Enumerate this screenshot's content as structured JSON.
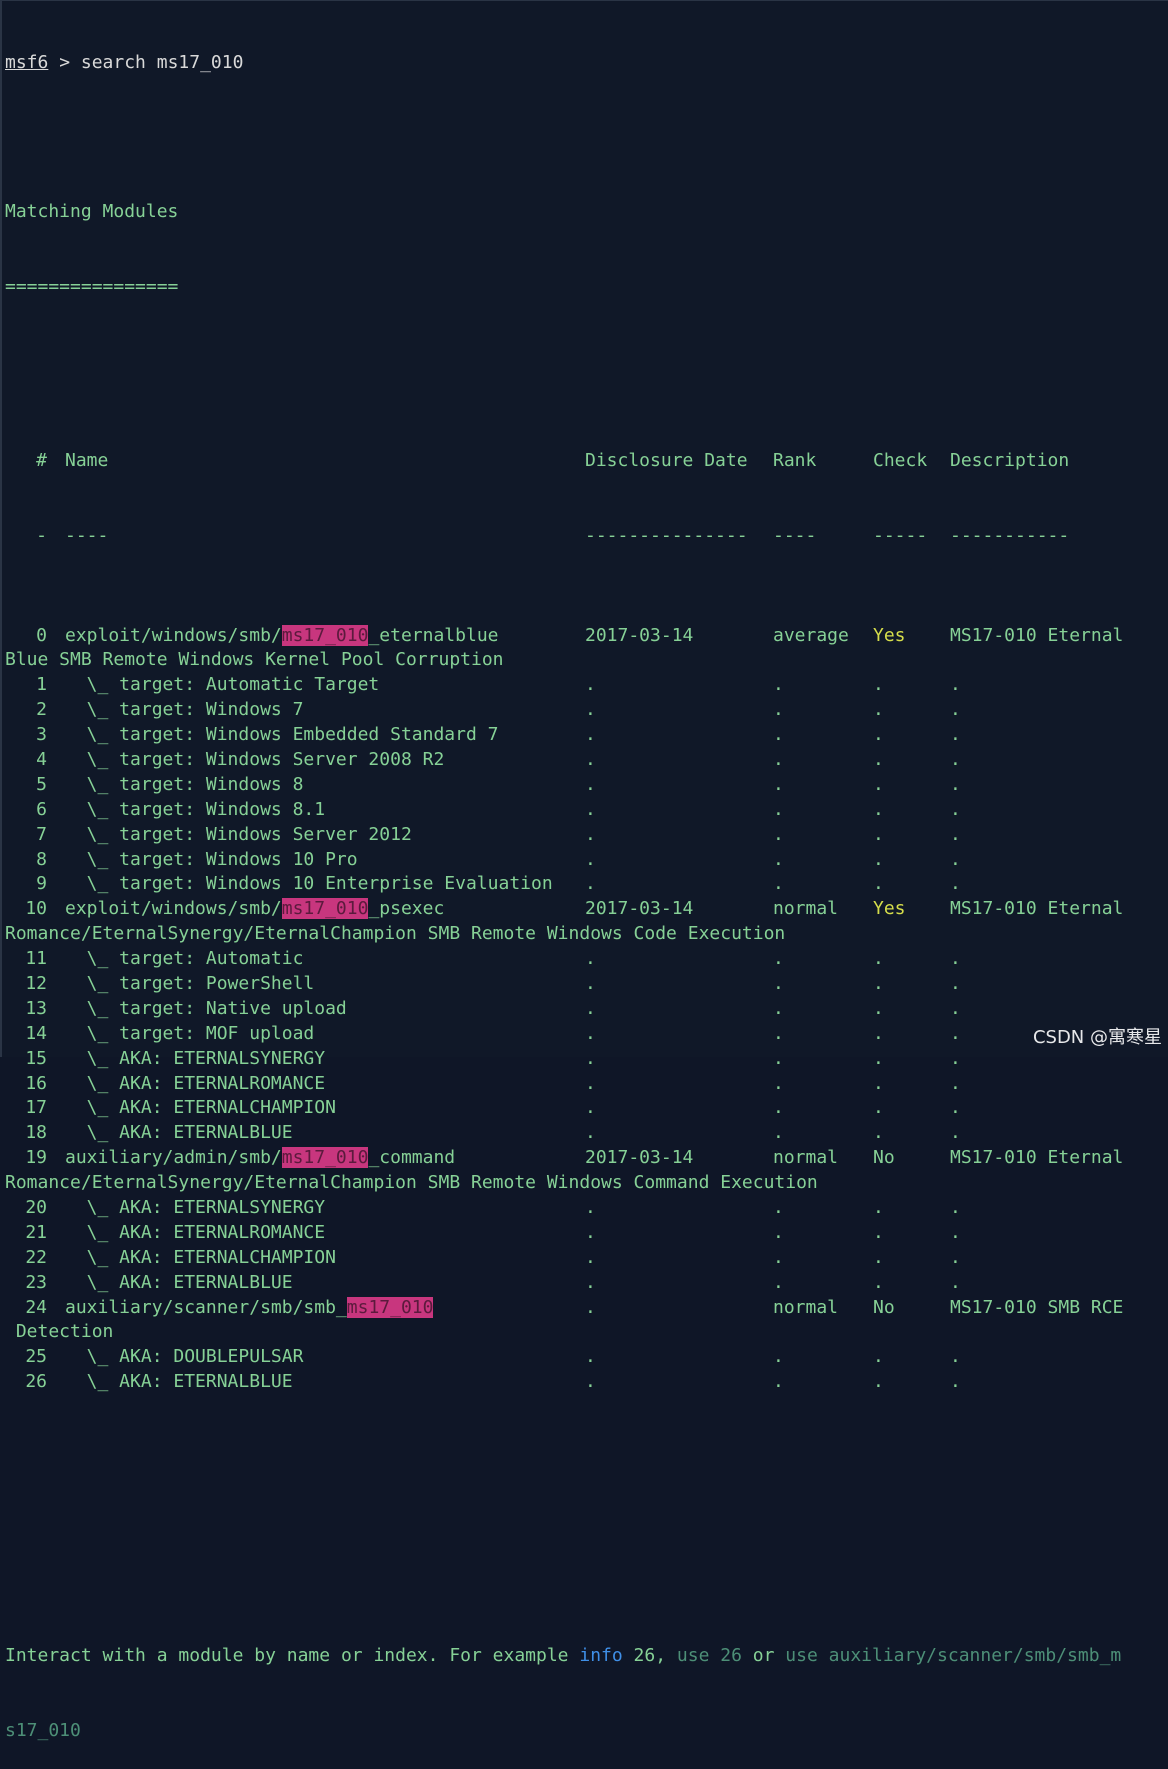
{
  "prompt": {
    "label": "msf6",
    "command": " > search ms17_010"
  },
  "heading": "Matching Modules",
  "underline": "================",
  "headers": {
    "num": "#",
    "name": "Name",
    "date": "Disclosure Date",
    "rank": "Rank",
    "check": "Check",
    "desc": "Description"
  },
  "dashes": {
    "num": "-",
    "name": "----",
    "date": "---------------",
    "rank": "----",
    "check": "-----",
    "desc": "-----------"
  },
  "rows": [
    {
      "num": "0",
      "pre": "exploit/windows/smb/",
      "hl": "ms17_010",
      "post": "_eternalblue",
      "date": "2017-03-14",
      "rank": "average",
      "check": "Yes",
      "desc": "MS17-010 Eternal",
      "wrap": "Blue SMB Remote Windows Kernel Pool Corruption"
    },
    {
      "num": "1",
      "pre": "  \\_ target: Automatic Target",
      "date": ".",
      "rank": ".",
      "check": ".",
      "desc": "."
    },
    {
      "num": "2",
      "pre": "  \\_ target: Windows 7",
      "date": ".",
      "rank": ".",
      "check": ".",
      "desc": "."
    },
    {
      "num": "3",
      "pre": "  \\_ target: Windows Embedded Standard 7",
      "date": ".",
      "rank": ".",
      "check": ".",
      "desc": "."
    },
    {
      "num": "4",
      "pre": "  \\_ target: Windows Server 2008 R2",
      "date": ".",
      "rank": ".",
      "check": ".",
      "desc": "."
    },
    {
      "num": "5",
      "pre": "  \\_ target: Windows 8",
      "date": ".",
      "rank": ".",
      "check": ".",
      "desc": "."
    },
    {
      "num": "6",
      "pre": "  \\_ target: Windows 8.1",
      "date": ".",
      "rank": ".",
      "check": ".",
      "desc": "."
    },
    {
      "num": "7",
      "pre": "  \\_ target: Windows Server 2012",
      "date": ".",
      "rank": ".",
      "check": ".",
      "desc": "."
    },
    {
      "num": "8",
      "pre": "  \\_ target: Windows 10 Pro",
      "date": ".",
      "rank": ".",
      "check": ".",
      "desc": "."
    },
    {
      "num": "9",
      "pre": "  \\_ target: Windows 10 Enterprise Evaluation",
      "date": ".",
      "rank": ".",
      "check": ".",
      "desc": "."
    },
    {
      "num": "10",
      "pre": "exploit/windows/smb/",
      "hl": "ms17_010",
      "post": "_psexec",
      "date": "2017-03-14",
      "rank": "normal",
      "check": "Yes",
      "desc": "MS17-010 Eternal",
      "wrap": "Romance/EternalSynergy/EternalChampion SMB Remote Windows Code Execution"
    },
    {
      "num": "11",
      "pre": "  \\_ target: Automatic",
      "date": ".",
      "rank": ".",
      "check": ".",
      "desc": "."
    },
    {
      "num": "12",
      "pre": "  \\_ target: PowerShell",
      "date": ".",
      "rank": ".",
      "check": ".",
      "desc": "."
    },
    {
      "num": "13",
      "pre": "  \\_ target: Native upload",
      "date": ".",
      "rank": ".",
      "check": ".",
      "desc": "."
    },
    {
      "num": "14",
      "pre": "  \\_ target: MOF upload",
      "date": ".",
      "rank": ".",
      "check": ".",
      "desc": "."
    },
    {
      "num": "15",
      "pre": "  \\_ AKA: ETERNALSYNERGY",
      "date": ".",
      "rank": ".",
      "check": ".",
      "desc": "."
    },
    {
      "num": "16",
      "pre": "  \\_ AKA: ETERNALROMANCE",
      "date": ".",
      "rank": ".",
      "check": ".",
      "desc": "."
    },
    {
      "num": "17",
      "pre": "  \\_ AKA: ETERNALCHAMPION",
      "date": ".",
      "rank": ".",
      "check": ".",
      "desc": "."
    },
    {
      "num": "18",
      "pre": "  \\_ AKA: ETERNALBLUE",
      "date": ".",
      "rank": ".",
      "check": ".",
      "desc": "."
    },
    {
      "num": "19",
      "pre": "auxiliary/admin/smb/",
      "hl": "ms17_010",
      "post": "_command",
      "date": "2017-03-14",
      "rank": "normal",
      "check": "No",
      "desc": "MS17-010 Eternal",
      "wrap": "Romance/EternalSynergy/EternalChampion SMB Remote Windows Command Execution"
    },
    {
      "num": "20",
      "pre": "  \\_ AKA: ETERNALSYNERGY",
      "date": ".",
      "rank": ".",
      "check": ".",
      "desc": "."
    },
    {
      "num": "21",
      "pre": "  \\_ AKA: ETERNALROMANCE",
      "date": ".",
      "rank": ".",
      "check": ".",
      "desc": "."
    },
    {
      "num": "22",
      "pre": "  \\_ AKA: ETERNALCHAMPION",
      "date": ".",
      "rank": ".",
      "check": ".",
      "desc": "."
    },
    {
      "num": "23",
      "pre": "  \\_ AKA: ETERNALBLUE",
      "date": ".",
      "rank": ".",
      "check": ".",
      "desc": "."
    },
    {
      "num": "24",
      "pre": "auxiliary/scanner/smb/smb_",
      "hl": "ms17_010",
      "post": "",
      "date": ".",
      "rank": "normal",
      "check": "No",
      "desc": "MS17-010 SMB RCE",
      "wrap": " Detection"
    },
    {
      "num": "25",
      "pre": "  \\_ AKA: DOUBLEPULSAR",
      "date": ".",
      "rank": ".",
      "check": ".",
      "desc": "."
    },
    {
      "num": "26",
      "pre": "  \\_ AKA: ETERNALBLUE",
      "date": ".",
      "rank": ".",
      "check": ".",
      "desc": "."
    }
  ],
  "footer": {
    "part1": "Interact with a module by name or index. For example ",
    "kw_info": "info",
    "part2": " 26, ",
    "kw_use1": "use 26",
    "part3": " or ",
    "kw_use2": "use auxiliary/scanner/smb/smb_m",
    "line2": "s17_010"
  },
  "watermark": "CSDN @寓寒星",
  "colors": {
    "background": "#101828",
    "text": "#86d196",
    "highlight": "#c8367e",
    "yes": "#d6de4b",
    "keyword": "#3f8fe7"
  }
}
